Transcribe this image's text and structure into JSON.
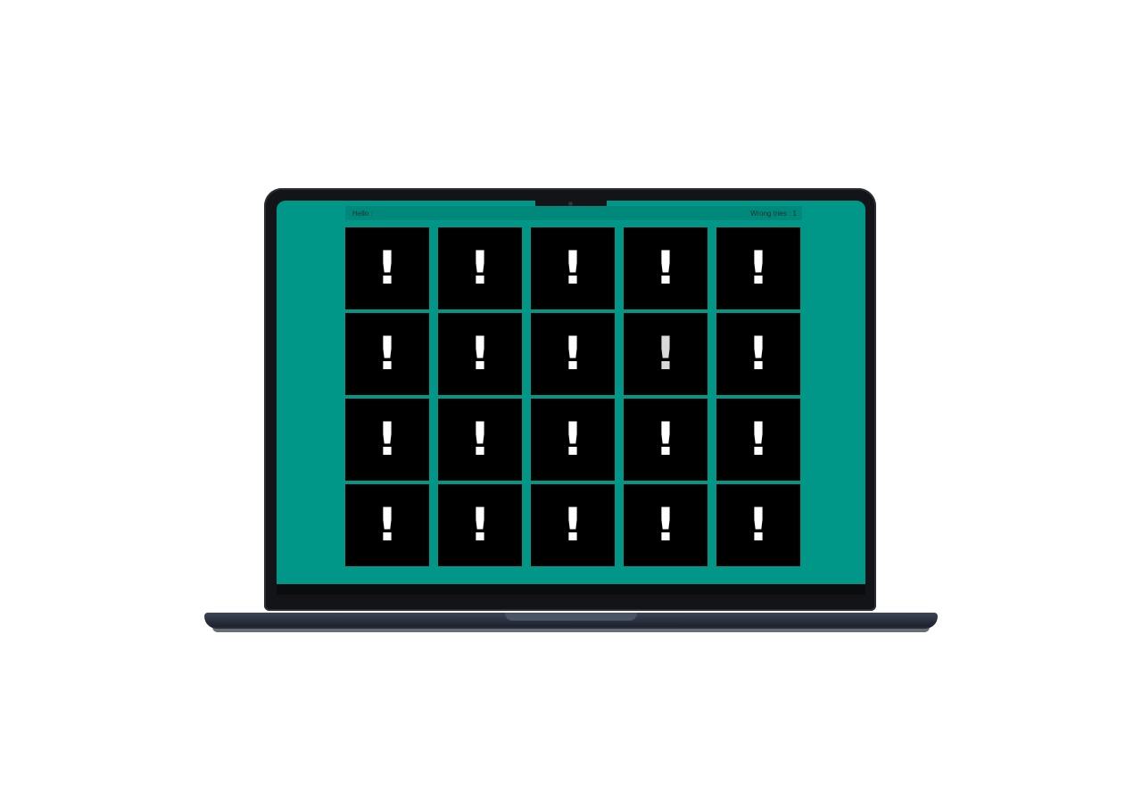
{
  "header": {
    "greeting": "Hello :",
    "wrong_tries_label": "Wrong tries : 1"
  },
  "board": {
    "rows": 4,
    "columns": 5,
    "card_face_down_symbol": "!",
    "cards": [
      {
        "symbol": "!"
      },
      {
        "symbol": "!"
      },
      {
        "symbol": "!"
      },
      {
        "symbol": "!"
      },
      {
        "symbol": "!"
      },
      {
        "symbol": "!"
      },
      {
        "symbol": "!"
      },
      {
        "symbol": "!"
      },
      {
        "symbol": "!",
        "dim": true
      },
      {
        "symbol": "!"
      },
      {
        "symbol": "!"
      },
      {
        "symbol": "!"
      },
      {
        "symbol": "!"
      },
      {
        "symbol": "!"
      },
      {
        "symbol": "!"
      },
      {
        "symbol": "!"
      },
      {
        "symbol": "!"
      },
      {
        "symbol": "!"
      },
      {
        "symbol": "!"
      },
      {
        "symbol": "!"
      }
    ]
  },
  "colors": {
    "screen_background": "#009688",
    "card_background": "#000000",
    "card_symbol": "#ffffff"
  }
}
